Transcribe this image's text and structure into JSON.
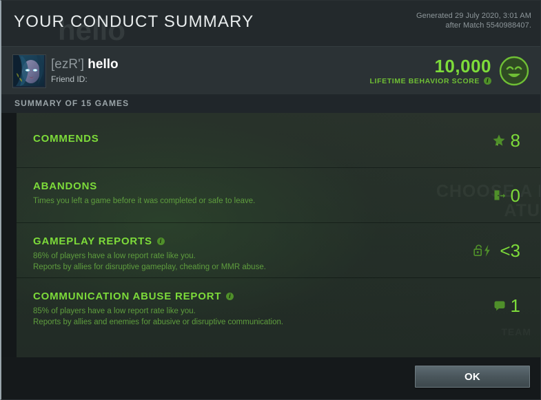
{
  "window": {
    "title": "YOUR CONDUCT SUMMARY",
    "ghost_text": "hello"
  },
  "header": {
    "generated_line1": "Generated 29 July 2020, 3:01 AM",
    "generated_line2": "after Match 5540988407."
  },
  "player": {
    "tag": "[ezR']",
    "nickname": "hello",
    "friend_id_label": "Friend ID:",
    "avatar_icon": "hero-portrait-avatar"
  },
  "behavior": {
    "score": "10,000",
    "label": "LIFETIME BEHAVIOR SCORE",
    "info_icon": "info-icon",
    "info_glyph": "i",
    "face_icon": "happy-face-icon"
  },
  "summary": {
    "label": "SUMMARY OF 15 GAMES"
  },
  "rows": [
    {
      "title": "COMMENDS",
      "sub1": "",
      "sub2": "",
      "value": "8",
      "icon": "star-icon",
      "has_info": false
    },
    {
      "title": "ABANDONS",
      "sub1": "Times you left a game before it was completed or safe to leave.",
      "sub2": "",
      "value": "0",
      "icon": "exit-door-icon",
      "has_info": false
    },
    {
      "title": "GAMEPLAY REPORTS",
      "sub1": "86% of players have a low report rate like you.",
      "sub2": "Reports by allies for disruptive gameplay, cheating or MMR abuse.",
      "value": "<3",
      "icon": "lock-bolt-icon",
      "has_info": true,
      "info_glyph": "i"
    },
    {
      "title": "COMMUNICATION ABUSE REPORT",
      "sub1": "85% of players have a low report rate like you.",
      "sub2": "Reports by allies and enemies for abusive or disruptive communication.",
      "value": "1",
      "icon": "speech-bubble-icon",
      "has_info": true,
      "info_glyph": "i"
    }
  ],
  "background_ghost": {
    "line1": "CHOOSE A HE",
    "line2": "ATUR",
    "line3": "TEAM"
  },
  "footer": {
    "ok_label": "OK"
  },
  "colors": {
    "accent_green": "#7ddb3a",
    "muted_green": "#5f9e3e",
    "header_bg": "#23292c",
    "panel_bg": "#2a332c",
    "button_bg": "#4a565c"
  }
}
